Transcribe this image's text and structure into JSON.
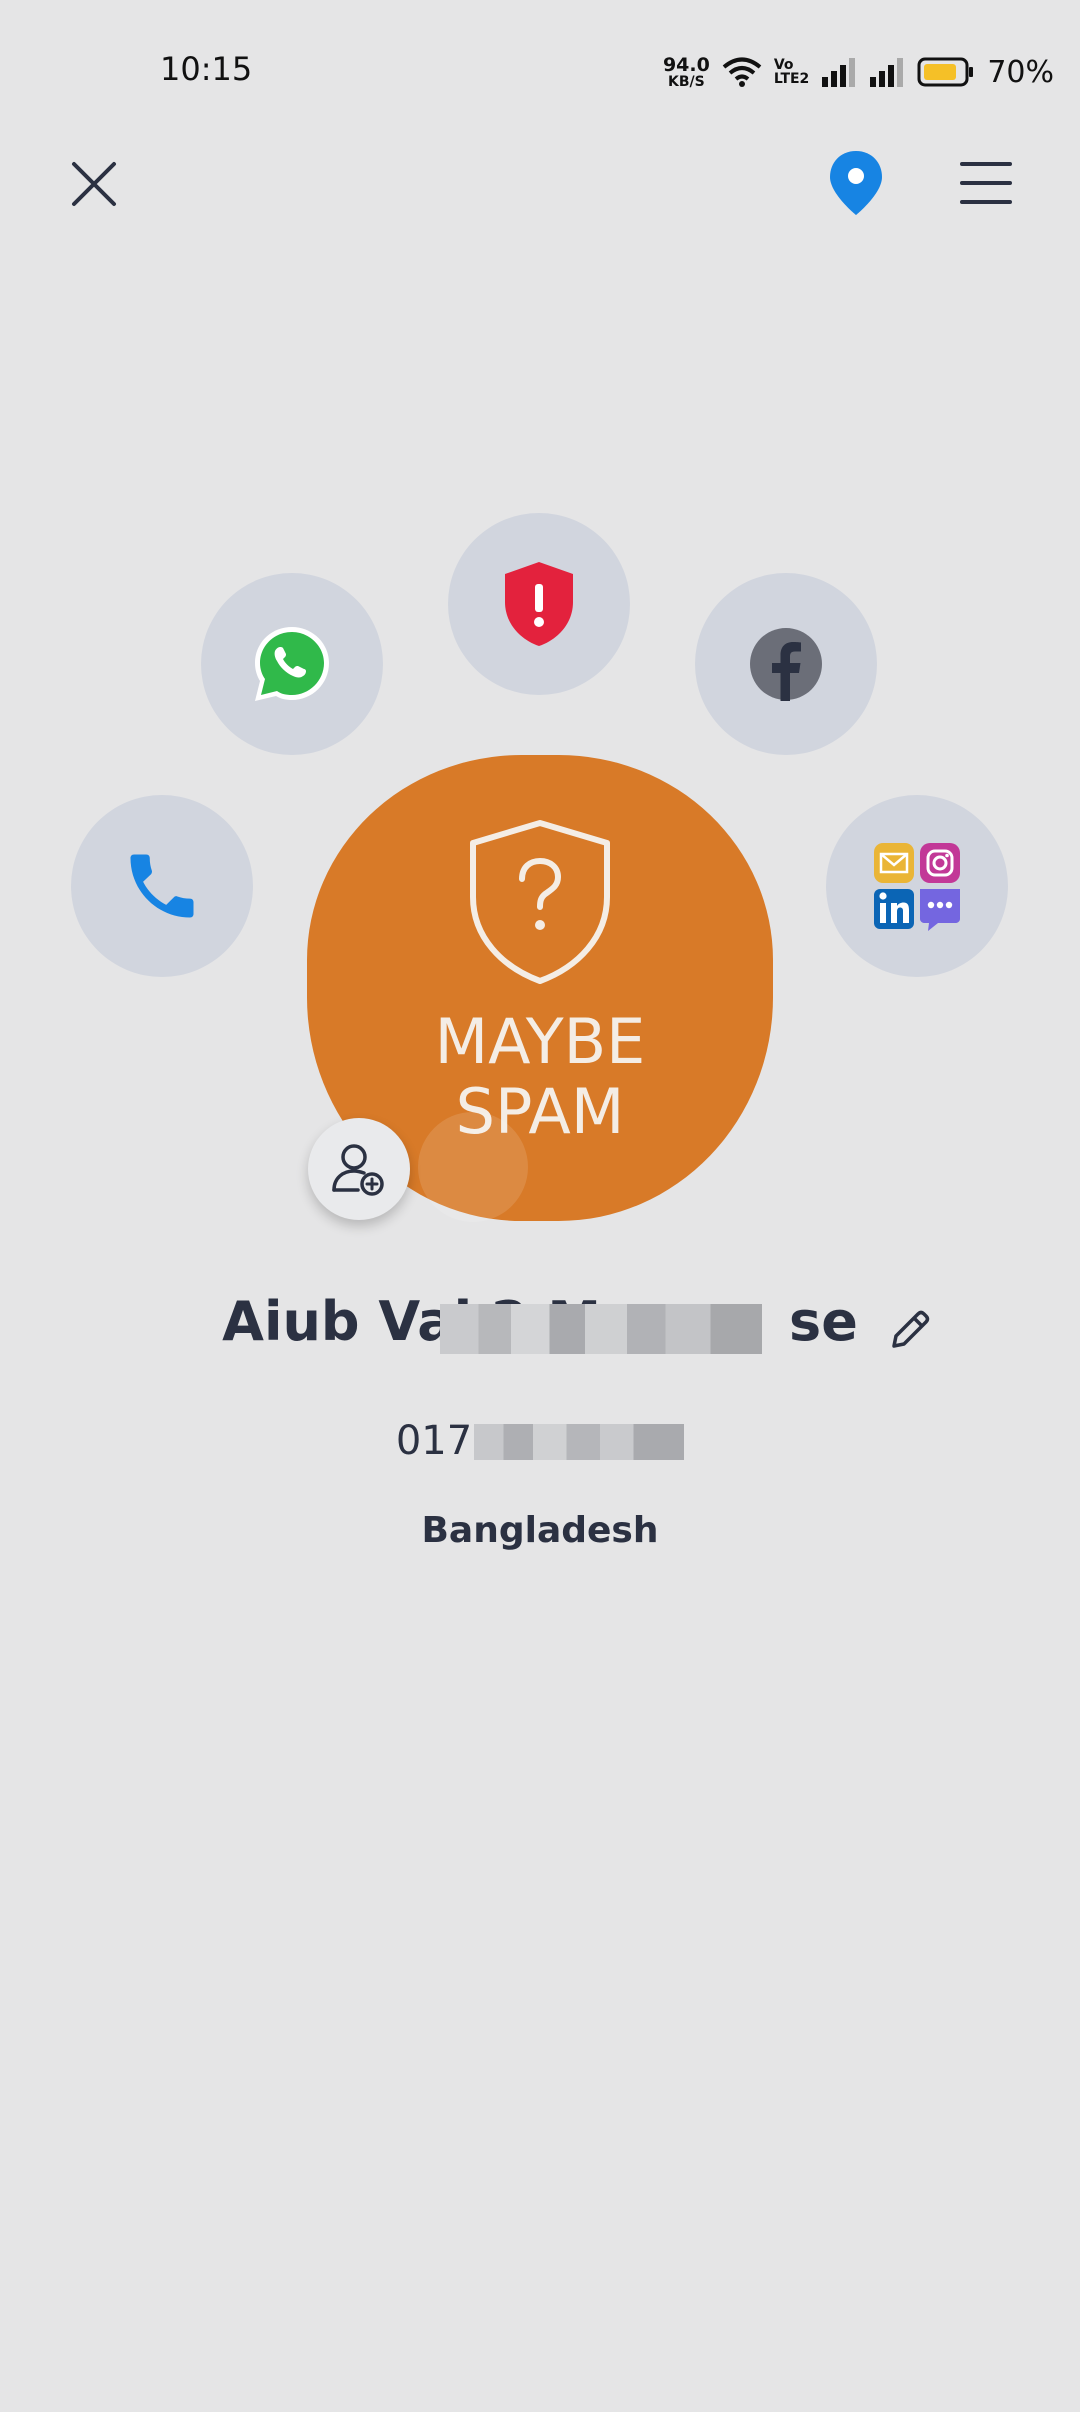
{
  "status_bar": {
    "time": "10:15",
    "net_speed_value": "94.0",
    "net_speed_unit": "KB/S",
    "volte_top": "Vo",
    "volte_bottom": "LTE2",
    "battery_percent": "70%"
  },
  "header": {
    "close_icon": "close-icon",
    "location_icon": "location-pin-icon",
    "menu_icon": "menu-icon"
  },
  "actions": {
    "call_icon": "phone-icon",
    "whatsapp_icon": "whatsapp-icon",
    "spam_shield_icon": "spam-shield-icon",
    "facebook_icon": "facebook-icon",
    "social_icon": "social-apps-icon"
  },
  "spam_status": {
    "line1": "MAYBE",
    "line2": "SPAM"
  },
  "contact": {
    "name": "Aiub Vai 2 M          se",
    "phone": "017",
    "country": "Bangladesh"
  },
  "colors": {
    "background": "#e5e5e6",
    "spam_orange": "#d87a28",
    "bubble": "#d1d5de",
    "accent_blue": "#1784e3",
    "alert_red": "#e3223d",
    "battery_yellow": "#f5c027"
  }
}
